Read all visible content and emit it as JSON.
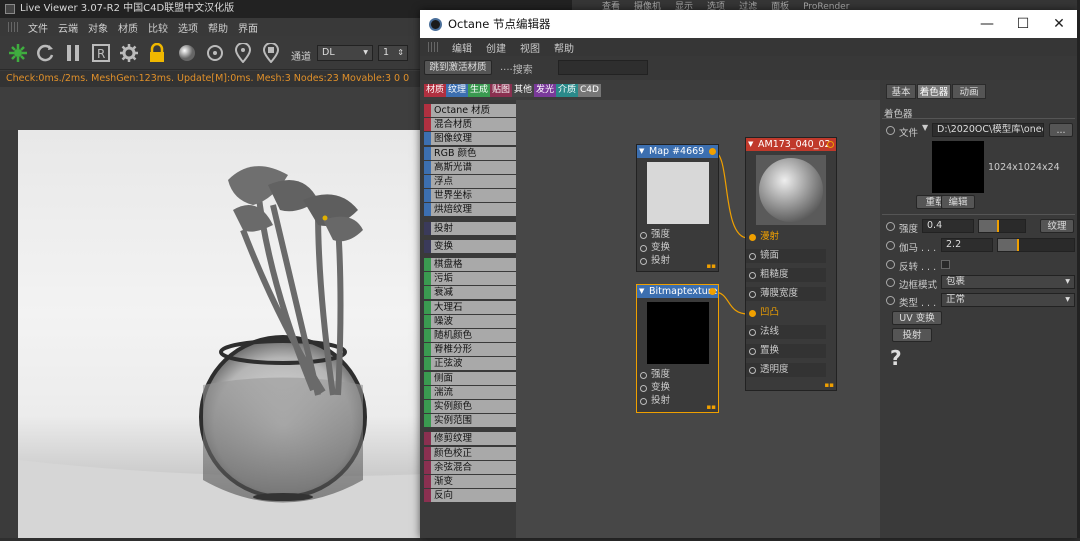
{
  "live_viewer": {
    "title": "Live Viewer 3.07-R2 中国C4D联盟中文汉化版",
    "menu": [
      "文件",
      "云端",
      "对象",
      "材质",
      "比较",
      "选项",
      "帮助",
      "界面"
    ],
    "channel_label": "通道",
    "channel_value": "DL",
    "spinner_value": "1",
    "status": "Check:0ms./2ms. MeshGen:123ms. Update[M]:0ms. Mesh:3 Nodes:23 Movable:3  0 0"
  },
  "behind_window_menu": [
    "查看",
    "摄像机",
    "显示",
    "选项",
    "过滤",
    "面板",
    "ProRender"
  ],
  "node_editor": {
    "title": "Octane 节点编辑器",
    "menu": [
      "编辑",
      "创建",
      "视图",
      "帮助"
    ],
    "toolbar": {
      "button": "跳到激活材质",
      "search_label": "搜索"
    },
    "categories": [
      {
        "label": "材质",
        "color": "#b03040"
      },
      {
        "label": "纹理",
        "color": "#3c6fb0"
      },
      {
        "label": "生成",
        "color": "#3a9a50"
      },
      {
        "label": "贴图",
        "color": "#8a3050"
      },
      {
        "label": "其他",
        "color": "#444444"
      },
      {
        "label": "发光",
        "color": "#7a3a9a"
      },
      {
        "label": "介质",
        "color": "#2a8a8a"
      },
      {
        "label": "C4D",
        "color": "#8a8a8a"
      }
    ],
    "list_items": [
      {
        "label": "Octane 材质",
        "color": "#b03040"
      },
      {
        "label": "混合材质",
        "color": "#b03040"
      },
      {
        "label": "图像纹理",
        "color": "#3c6fb0"
      },
      {
        "label": "RGB 颜色",
        "color": "#3c6fb0"
      },
      {
        "label": "高斯光谱",
        "color": "#3c6fb0"
      },
      {
        "label": "浮点",
        "color": "#3c6fb0"
      },
      {
        "label": "世界坐标",
        "color": "#3c6fb0"
      },
      {
        "label": "烘焙纹理",
        "color": "#3c6fb0"
      },
      {
        "label": "投射",
        "color": "#3a3a5a"
      },
      {
        "label": "变换",
        "color": "#3a3a5a"
      },
      {
        "label": "棋盘格",
        "color": "#3a9a50"
      },
      {
        "label": "污垢",
        "color": "#3a9a50"
      },
      {
        "label": "衰减",
        "color": "#3a9a50"
      },
      {
        "label": "大理石",
        "color": "#3a9a50"
      },
      {
        "label": "噪波",
        "color": "#3a9a50"
      },
      {
        "label": "随机颜色",
        "color": "#3a9a50"
      },
      {
        "label": "脊椎分形",
        "color": "#3a9a50"
      },
      {
        "label": "正弦波",
        "color": "#3a9a50"
      },
      {
        "label": "侧面",
        "color": "#3a9a50"
      },
      {
        "label": "湍流",
        "color": "#3a9a50"
      },
      {
        "label": "实例颜色",
        "color": "#3a9a50"
      },
      {
        "label": "实例范围",
        "color": "#3a9a50"
      },
      {
        "label": "修剪纹理",
        "color": "#8a3050"
      },
      {
        "label": "颜色校正",
        "color": "#8a3050"
      },
      {
        "label": "余弦混合",
        "color": "#8a3050"
      },
      {
        "label": "渐变",
        "color": "#8a3050"
      },
      {
        "label": "反向",
        "color": "#8a3050"
      }
    ],
    "nodes": {
      "map": {
        "title": "Map #4669",
        "pins": [
          "强度",
          "变换",
          "投射"
        ]
      },
      "bitmap": {
        "title": "Bitmaptexture",
        "pins": [
          "强度",
          "变换",
          "投射"
        ]
      },
      "material": {
        "title": "AM173_040_02",
        "pins": [
          "漫射",
          "镜面",
          "粗糙度",
          "薄膜宽度",
          "凹凸",
          "法线",
          "置换",
          "透明度"
        ]
      }
    },
    "panel": {
      "tabs": [
        "基本",
        "着色器",
        "动画"
      ],
      "section": "着色器",
      "file_label": "文件",
      "file_path": "D:\\2020OC\\模型库\\onec",
      "browse": "...",
      "resolution": "1024x1024x24",
      "reload": "重载",
      "edit": "编辑",
      "strength_label": "强度",
      "strength_value": "0.4",
      "strength_level": 0.4,
      "texture_button": "纹理",
      "gamma_label": "伽马 . . .",
      "gamma_value": "2.2",
      "gamma_level": 0.25,
      "invert_label": "反转 . . .",
      "border_label": "边框模式",
      "border_value": "包裹",
      "type_label": "类型 . . .",
      "type_value": "正常",
      "uv_button": "UV 变换",
      "projection_button": "投射",
      "help_icon": "?"
    }
  },
  "colors": {
    "accent": "#f0a000",
    "material_header": "#c0392b",
    "texture_header": "#3c6fb0"
  }
}
